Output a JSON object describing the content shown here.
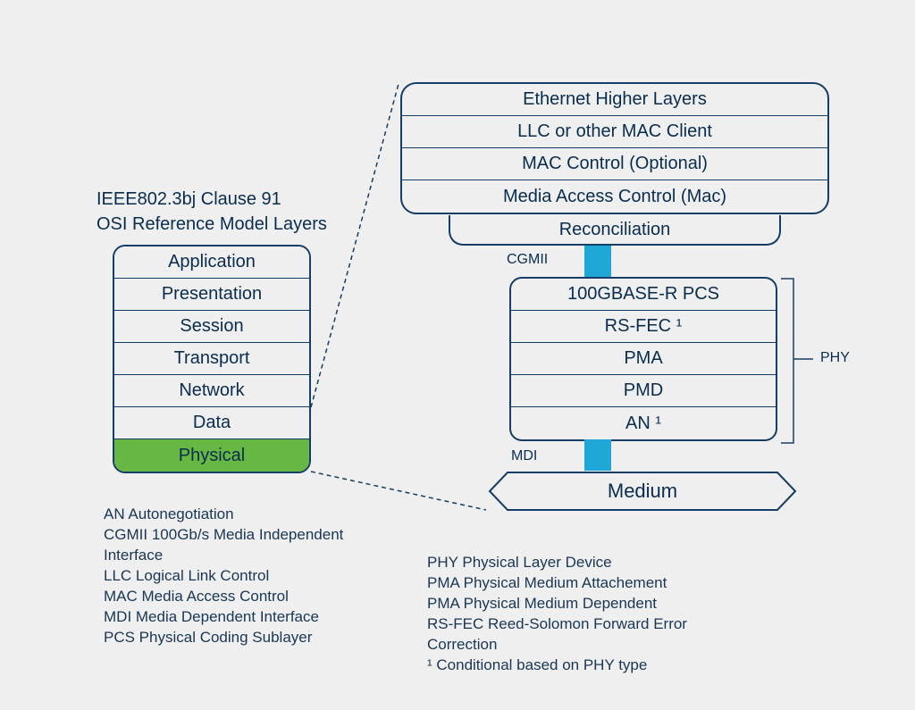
{
  "header": {
    "line1": "IEEE802.3bj Clause 91",
    "line2": "OSI Reference Model Layers"
  },
  "osiLayers": [
    "Application",
    "Presentation",
    "Session",
    "Transport",
    "Network",
    "Data",
    "Physical"
  ],
  "higherLayers": [
    "Ethernet Higher Layers",
    "LLC or other MAC Client",
    "MAC Control (Optional)",
    "Media Access Control (Mac)"
  ],
  "recon": "Reconciliation",
  "connectorLabels": {
    "cgmii": "CGMII",
    "mdi": "MDI"
  },
  "phyLayers": [
    "100GBASE-R PCS",
    "RS-FEC ¹",
    "PMA",
    "PMD",
    "AN ¹"
  ],
  "phyBracketLabel": "PHY",
  "medium": "Medium",
  "legendLeft": [
    "AN Autonegotiation",
    "CGMII 100Gb/s Media Independent Interface",
    "LLC Logical Link Control",
    "MAC Media Access Control",
    "MDI Media Dependent Interface",
    "PCS Physical Coding Sublayer"
  ],
  "legendRight": [
    "PHY Physical Layer Device",
    "PMA Physical Medium Attachement",
    "PMA Physical Medium Dependent",
    "RS-FEC Reed-Solomon Forward Error Correction",
    "¹ Conditional based on PHY type"
  ],
  "colors": {
    "border": "#163d66",
    "highlight": "#67b744",
    "connector": "#1fa8d7"
  }
}
